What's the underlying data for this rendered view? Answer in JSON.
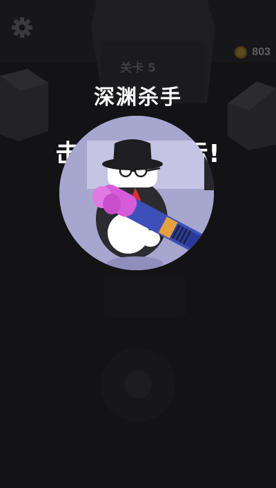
{
  "hud": {
    "settings_icon": "gear-icon",
    "coin_icon": "coin-icon",
    "coin_count": "803"
  },
  "level": {
    "label": "关卡 5"
  },
  "boss": {
    "name": "深渊杀手"
  },
  "mission": {
    "text": "击败终极目标!"
  },
  "portrait": {
    "subject": "boss-portrait",
    "weapon": "bazooka"
  },
  "joystick": {
    "name": "virtual-joystick"
  },
  "colors": {
    "background": "#131316",
    "portrait_bg": "#a7a6cf",
    "coin": "#b89a2a",
    "weapon_pink": "#d65bd8",
    "weapon_blue": "#3d4fb8",
    "text_white": "#ffffff"
  }
}
